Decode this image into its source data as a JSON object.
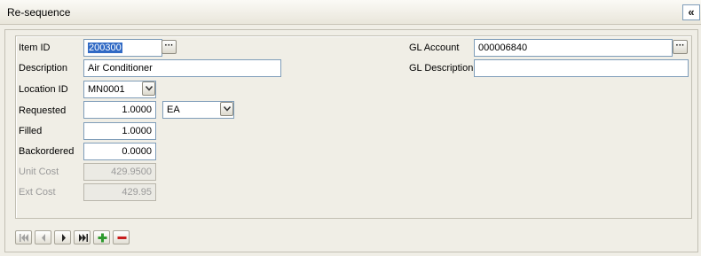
{
  "window": {
    "title": "Re-sequence",
    "collapse_glyph": "«"
  },
  "form": {
    "item_id": {
      "label": "Item ID",
      "value": "200300"
    },
    "description": {
      "label": "Description",
      "value": "Air Conditioner"
    },
    "location_id": {
      "label": "Location ID",
      "value": "MN0001"
    },
    "requested": {
      "label": "Requested",
      "value": "1.0000",
      "uom": "EA"
    },
    "filled": {
      "label": "Filled",
      "value": "1.0000"
    },
    "backordered": {
      "label": "Backordered",
      "value": "0.0000"
    },
    "unit_cost": {
      "label": "Unit Cost",
      "value": "429.9500"
    },
    "ext_cost": {
      "label": "Ext Cost",
      "value": "429.95"
    },
    "gl_account": {
      "label": "GL Account",
      "value": "000006840"
    },
    "gl_description": {
      "label": "GL Description",
      "value": ""
    }
  },
  "lookup_glyph": "···",
  "navigation": {
    "icons": [
      "first-record-icon",
      "previous-record-icon",
      "next-record-icon",
      "last-record-icon",
      "add-record-icon",
      "delete-record-icon"
    ]
  },
  "colors": {
    "add": "#2e9a2e",
    "delete": "#c81e1e",
    "selection": "#316ac5"
  }
}
